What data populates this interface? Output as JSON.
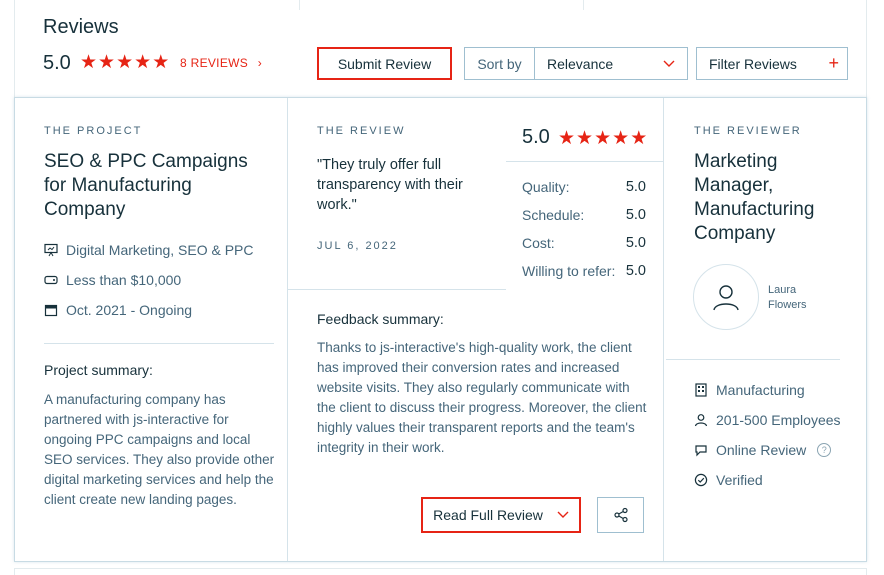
{
  "header": {
    "title": "Reviews",
    "rating": "5.0",
    "reviews_link": "8 REVIEWS",
    "reviews_chevron": "›",
    "submit_label": "Submit Review",
    "sort_label": "Sort by",
    "sort_value": "Relevance",
    "filter_label": "Filter Reviews",
    "filter_plus": "+"
  },
  "project": {
    "section_label": "THE PROJECT",
    "title": "SEO & PPC Campaigns for Manufacturing Company",
    "service": "Digital Marketing, SEO & PPC",
    "budget": "Less than $10,000",
    "dates": "Oct. 2021 - Ongoing",
    "summary_label": "Project summary:",
    "summary": "A manufacturing company has partnered with js-interactive for ongoing PPC campaigns and local SEO services. They also provide other digital marketing services and help the client create new landing pages."
  },
  "review": {
    "section_label": "THE REVIEW",
    "quote": "\"They truly offer full transparency with their work.\"",
    "date": "JUL 6, 2022",
    "score": "5.0",
    "scores": [
      {
        "label": "Quality:",
        "value": "5.0"
      },
      {
        "label": "Schedule:",
        "value": "5.0"
      },
      {
        "label": "Cost:",
        "value": "5.0"
      },
      {
        "label": "Willing to refer:",
        "value": "5.0"
      }
    ],
    "feedback_label": "Feedback summary:",
    "feedback": "Thanks to js-interactive's high-quality work, the client has improved their conversion rates and increased website visits. They also regularly communicate with the client to discuss their progress. Moreover, the client highly values their transparent reports and the team's integrity in their work.",
    "read_label": "Read Full Review"
  },
  "reviewer": {
    "section_label": "THE REVIEWER",
    "title": "Marketing Manager, Manufacturing Company",
    "name": "Laura Flowers",
    "industry": "Manufacturing",
    "employees": "201-500 Employees",
    "review_type": "Online Review",
    "help_mark": "?",
    "status": "Verified"
  },
  "colors": {
    "accent": "#e62415",
    "text_dark": "#17313b",
    "text_muted": "#45667a",
    "border": "#9fbfd0"
  },
  "star_glyph": "★"
}
